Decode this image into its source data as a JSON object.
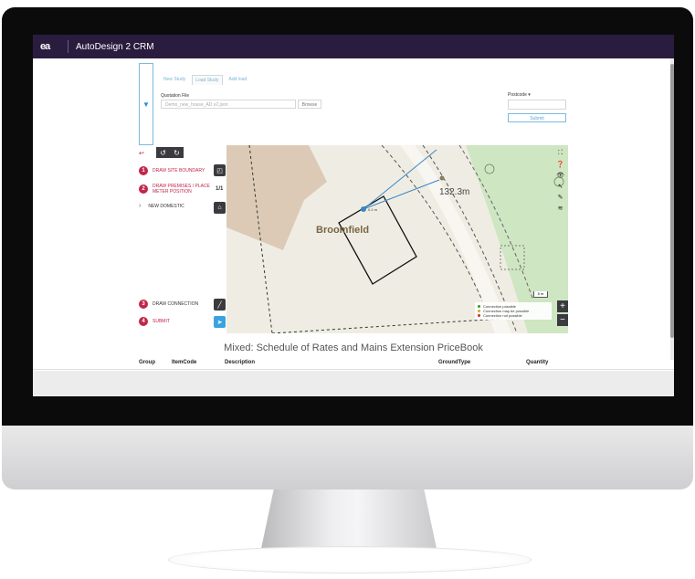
{
  "app": {
    "logo": "ea",
    "title": "AutoDesign 2 CRM"
  },
  "form": {
    "tabs": [
      "New Study",
      "Load Study",
      "Add load"
    ],
    "active_tab": 1,
    "quotation_label": "Quotation File",
    "quotation_value": "Demo_new_house_AD v2.json",
    "browse_label": "Browse",
    "postcode_label": "Postcode ▾",
    "postcode_value": "",
    "submit_label": "Submit"
  },
  "steps": {
    "back_icon": "↩",
    "draw_site_boundary": {
      "num": "1",
      "label": "DRAW SITE BOUNDARY"
    },
    "draw_premises": {
      "num": "2",
      "label_line1": "DRAW PREMISES / PLACE",
      "label_line2": "METER POSITION",
      "counter": "1/1"
    },
    "new_domestic": {
      "label": "NEW DOMESTIC"
    },
    "draw_connection": {
      "num": "3",
      "label": "DRAW CONNECTION"
    },
    "submit": {
      "num": "4",
      "label": "SUBMIT"
    }
  },
  "map": {
    "place_label": "Broomfield",
    "distance_label": "132.3m",
    "point_label": "0.1 m",
    "scale_label": "5 m",
    "zoom_in": "+",
    "zoom_out": "−",
    "legend": [
      {
        "label": "Connection possible",
        "color": "#2e9a3b"
      },
      {
        "label": "Connection may be possible",
        "color": "#e0a82a"
      },
      {
        "label": "Connection not possible",
        "color": "#d12b2b"
      }
    ]
  },
  "pricebook": {
    "title": "Mixed: Schedule of Rates and Mains Extension PriceBook",
    "columns": [
      "Group",
      "ItemCode",
      "Description",
      "GroundType",
      "Quantity"
    ]
  }
}
